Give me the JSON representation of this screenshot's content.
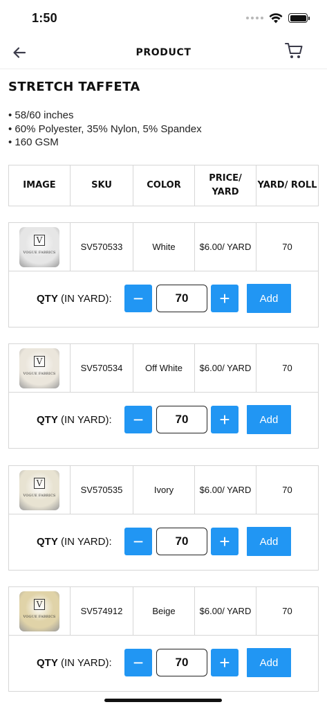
{
  "status_bar": {
    "time": "1:50"
  },
  "nav": {
    "title": "PRODUCT"
  },
  "product": {
    "title": "STRETCH TAFFETA",
    "specs": [
      "58/60 inches",
      "60% Polyester, 35% Nylon, 5% Spandex",
      "160 GSM"
    ]
  },
  "table_headers": [
    "IMAGE",
    "SKU",
    "COLOR",
    "PRICE/ YARD",
    "YARD/ ROLL"
  ],
  "qty_label": {
    "bold": "QTY",
    "rest": " (IN YARD):"
  },
  "add_label": "Add",
  "brand_text": "VOGUE FABRICS",
  "monogram": "V",
  "items": [
    {
      "sku": "SV570533",
      "color": "White",
      "price": "$6.00/ YARD",
      "yard_roll": "70",
      "qty": "70",
      "swatch_color": "#e6e6e6"
    },
    {
      "sku": "SV570534",
      "color": "Off White",
      "price": "$6.00/ YARD",
      "yard_roll": "70",
      "qty": "70",
      "swatch_color": "#ebe6dc"
    },
    {
      "sku": "SV570535",
      "color": "Ivory",
      "price": "$6.00/ YARD",
      "yard_roll": "70",
      "qty": "70",
      "swatch_color": "#e8e3d2"
    },
    {
      "sku": "SV574912",
      "color": "Beige",
      "price": "$6.00/ YARD",
      "yard_roll": "70",
      "qty": "70",
      "swatch_color": "#e0d3a8"
    }
  ]
}
